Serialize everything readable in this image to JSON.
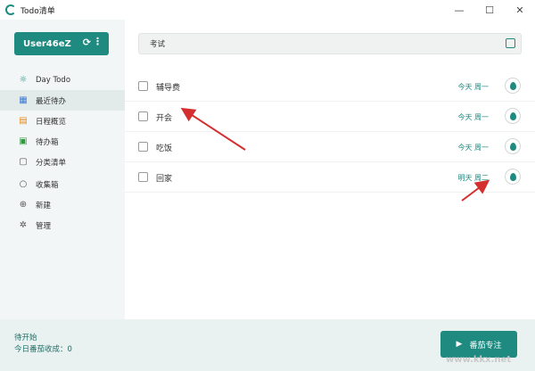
{
  "window": {
    "title": "Todo清单",
    "controls": [
      "—",
      "☐",
      "✕"
    ]
  },
  "sidebar": {
    "user_label": "User46eZ",
    "items": [
      {
        "label": "Day Todo",
        "icon": "☼"
      },
      {
        "label": "最近待办",
        "icon": "▦"
      },
      {
        "label": "日程概览",
        "icon": "▤"
      },
      {
        "label": "待办箱",
        "icon": "▣"
      },
      {
        "label": "分类清单",
        "icon": "▢"
      },
      {
        "label": "收集箱",
        "icon": "○"
      },
      {
        "label": "新建",
        "icon": "⊕"
      },
      {
        "label": "管理",
        "icon": "✲"
      }
    ]
  },
  "search": {
    "value": "考试"
  },
  "tasks": [
    {
      "name": "辅导费",
      "date": "今天 周一"
    },
    {
      "name": "开会",
      "date": "今天 周一"
    },
    {
      "name": "吃饭",
      "date": "今天 周一"
    },
    {
      "name": "回家",
      "date": "明天 周二"
    }
  ],
  "status": {
    "line1": "待开始",
    "line2": "今日番茄收成：0"
  },
  "pomodoro": {
    "label": "番茄专注"
  },
  "colors": {
    "accent": "#1f8a80",
    "arrow": "#d32f2f"
  },
  "watermark": "www.kkx.net"
}
